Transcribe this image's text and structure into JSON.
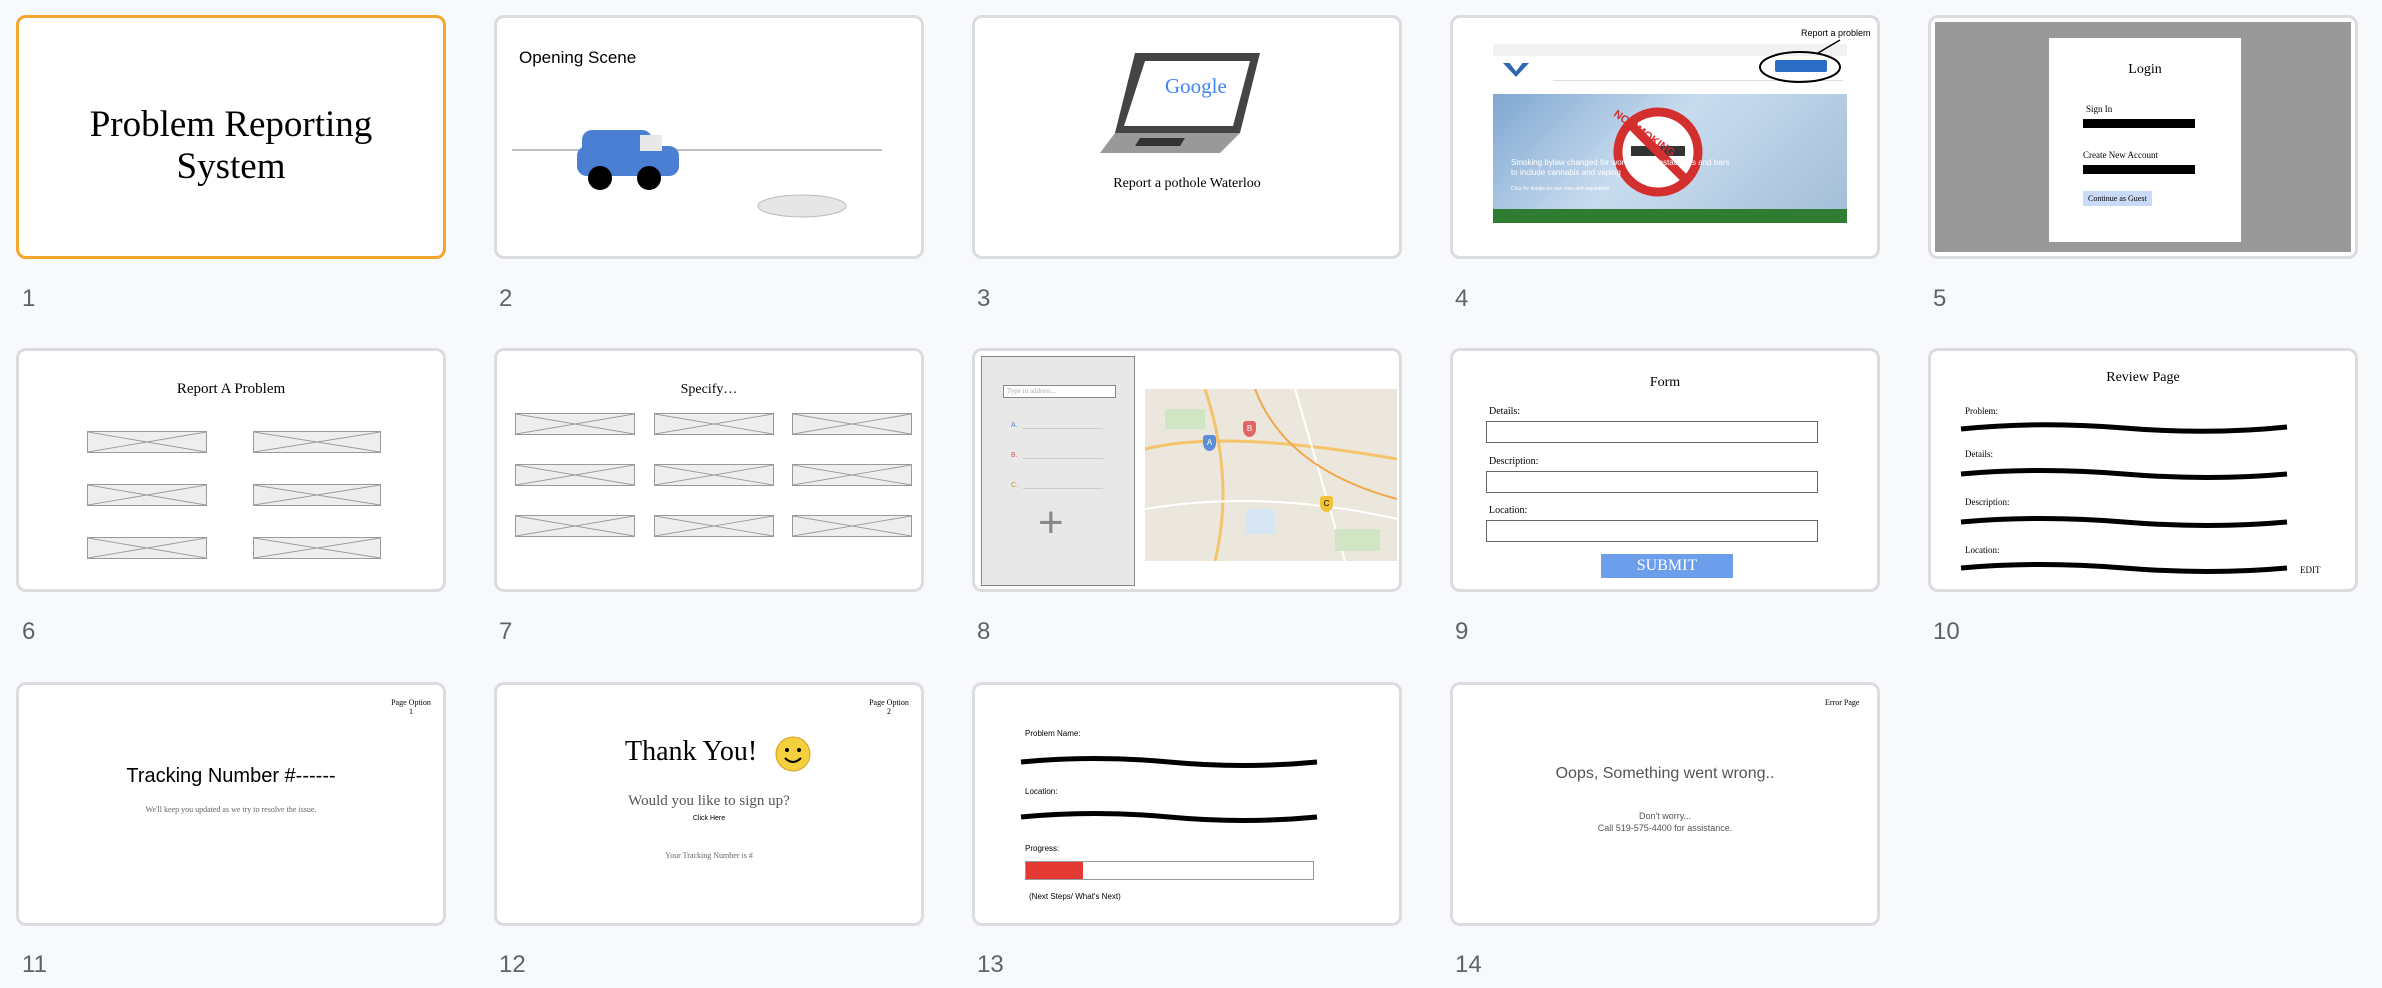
{
  "slide_numbers": [
    "1",
    "2",
    "3",
    "4",
    "5",
    "6",
    "7",
    "8",
    "9",
    "10",
    "11",
    "12",
    "13",
    "14"
  ],
  "slide1": {
    "title": "Problem Reporting System"
  },
  "slide2": {
    "title": "Opening Scene"
  },
  "slide3": {
    "caption": "Report a pothole Waterloo",
    "screen_logo": "Google"
  },
  "slide4": {
    "callout": "Report a problem",
    "banner_text": "NO SMOKING",
    "headline": "Smoking bylaw changed for workplaces, restaurants and bars to include cannabis and vaping",
    "sub_headline": "Click for details on new laws and regulations"
  },
  "slide5": {
    "title": "Login",
    "sign_in": "Sign In",
    "create_account": "Create New Account",
    "guest_button": "Continue as Guest"
  },
  "slide6": {
    "title": "Report A Problem"
  },
  "slide7": {
    "title": "Specify…"
  },
  "slide8": {
    "search_placeholder": "Type in address...",
    "list_labels": [
      "A.",
      "B.",
      "C."
    ],
    "pin_labels": [
      "A",
      "B",
      "C"
    ]
  },
  "slide9": {
    "title": "Form",
    "details_label": "Details:",
    "description_label": "Description:",
    "location_label": "Location:",
    "submit": "SUBMIT"
  },
  "slide10": {
    "title": "Review Page",
    "labels": [
      "Problem:",
      "Details:",
      "Description:",
      "Location:"
    ],
    "edit": "EDIT"
  },
  "slide11": {
    "corner": "Page Option 1",
    "title": "Tracking Number #------",
    "subtitle": "We'll keep you updated as we try to resolve the issue."
  },
  "slide12": {
    "corner": "Page Option 2",
    "title": "Thank You!",
    "question": "Would you like to sign up?",
    "link": "Click Here",
    "tracking": "Your Tracking Number is #"
  },
  "slide13": {
    "problem_label": "Problem Name:",
    "location_label": "Location:",
    "progress_label": "Progress:",
    "progress_value": 0.2,
    "next": "(Next Steps/ What's Next)"
  },
  "slide14": {
    "corner": "Error Page",
    "title": "Oops, Something went wrong..",
    "line1": "Don't worry...",
    "line2": "Call 519-575-4400 for assistance."
  },
  "colors": {
    "selected_border": "#f4a52c",
    "submit_blue": "#6d9eeb",
    "progress_red": "#e53935",
    "car_blue": "#4a7fd4"
  }
}
